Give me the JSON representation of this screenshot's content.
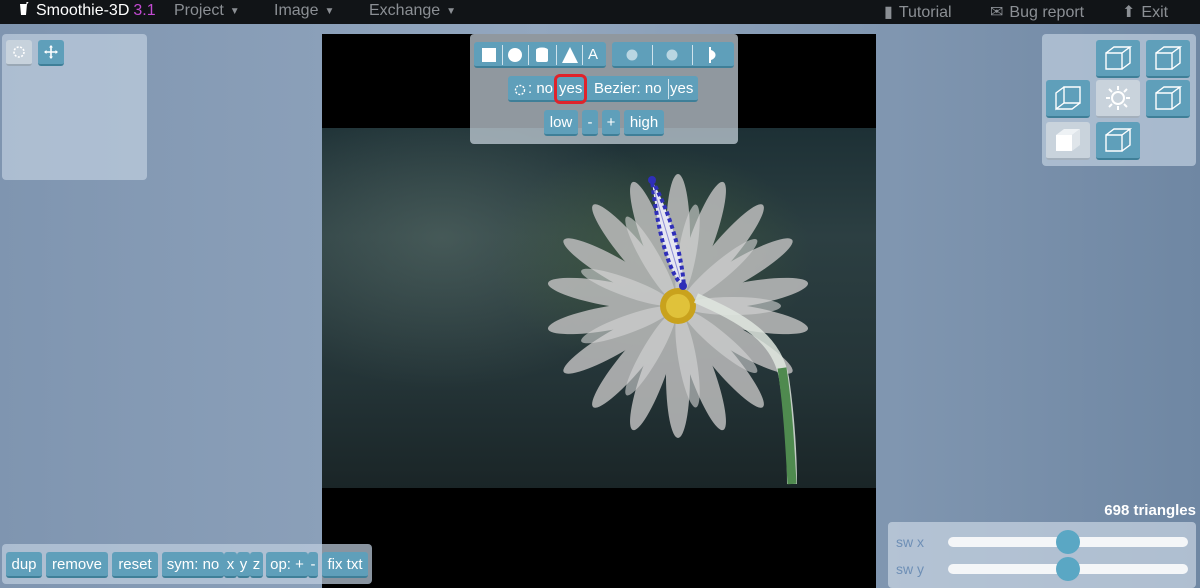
{
  "app": {
    "name": "Smoothie-3D",
    "version": "3.1"
  },
  "menu": {
    "project": "Project",
    "image": "Image",
    "exchange": "Exchange",
    "tutorial": "Tutorial",
    "bug_report": "Bug report",
    "exit": "Exit"
  },
  "tools": {
    "text_tool": "A",
    "circle_mode_label": ": no",
    "circle_mode_yes": "yes",
    "bezier_label": "Bezier: no",
    "bezier_yes": "yes",
    "low": "low",
    "minus": "-",
    "plus": "+",
    "high": "high"
  },
  "bottom_left": {
    "dup": "dup",
    "remove": "remove",
    "reset": "reset",
    "sym": "sym: no",
    "x": "x",
    "y": "y",
    "z": "z",
    "op": "op: +",
    "op_minus": "-",
    "fix_txt": "fix txt"
  },
  "stats": {
    "triangles": "698 triangles"
  },
  "sliders": {
    "sw_x_label": "sw x",
    "sw_y_label": "sw y",
    "sw_x_value": 0.5,
    "sw_y_value": 0.5
  },
  "colors": {
    "accent": "#5f9fba",
    "brand_version": "#c24ad1",
    "highlight": "#e0232b",
    "selection_outline": "#2f2fb8"
  }
}
